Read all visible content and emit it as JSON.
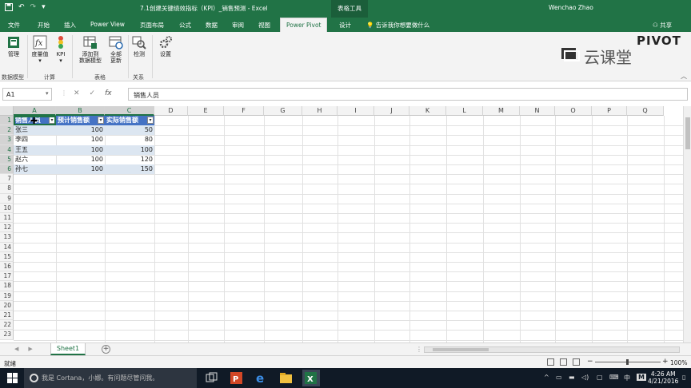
{
  "window": {
    "doc_title": "7.1创建关键绩效指标（KPI）_销售预测 - Excel",
    "context_tools": "表格工具",
    "user": "Wenchao Zhao"
  },
  "ribbon_tabs": [
    "文件",
    "开始",
    "插入",
    "Power View",
    "页面布局",
    "公式",
    "数据",
    "审阅",
    "视图",
    "Power Pivot",
    "设计"
  ],
  "tell_me": "告诉我你想要做什么",
  "share_label": "共享",
  "ribbon": {
    "buttons": {
      "manage": "管理",
      "measures": "度量值",
      "kpi": "KPI",
      "add_to_model_1": "添加到",
      "add_to_model_2": "数据模型",
      "refresh_all_1": "全部",
      "refresh_all_2": "更新",
      "detect": "检测",
      "settings": "设置"
    },
    "groups": {
      "data_model": "数据模型",
      "calc": "计算",
      "tables": "表格",
      "relations": "关系"
    }
  },
  "watermark": {
    "text": "云课堂",
    "subtext": "PIVOT"
  },
  "formula_bar": {
    "name_box": "A1",
    "fx": "fx",
    "formula": "销售人员"
  },
  "columns": [
    "A",
    "B",
    "C",
    "D",
    "E",
    "F",
    "G",
    "H",
    "I",
    "J",
    "K",
    "L",
    "M",
    "N",
    "O",
    "P",
    "Q"
  ],
  "rows": [
    "1",
    "2",
    "3",
    "4",
    "5",
    "6",
    "7",
    "8",
    "9",
    "10",
    "11",
    "12",
    "13",
    "14",
    "15",
    "16",
    "17",
    "18",
    "19",
    "20",
    "21",
    "22",
    "23"
  ],
  "table": {
    "headers": [
      "销售人员",
      "预计销售额",
      "实际销售额"
    ],
    "rows": [
      [
        "张三",
        "100",
        "50"
      ],
      [
        "李四",
        "100",
        "80"
      ],
      [
        "王五",
        "100",
        "100"
      ],
      [
        "赵六",
        "100",
        "120"
      ],
      [
        "孙七",
        "100",
        "150"
      ]
    ]
  },
  "sheet_tab": "Sheet1",
  "status": {
    "text": "就绪",
    "zoom": "100%"
  },
  "taskbar": {
    "cortana": "我是 Cortana，小娜。有问题尽管问我。",
    "time": "4:26 AM",
    "date": "4/21/2016",
    "ime": "中",
    "ime2": "M"
  },
  "colors": {
    "excel_green": "#217346",
    "table_header": "#4472c4",
    "table_band": "#dce6f1"
  }
}
